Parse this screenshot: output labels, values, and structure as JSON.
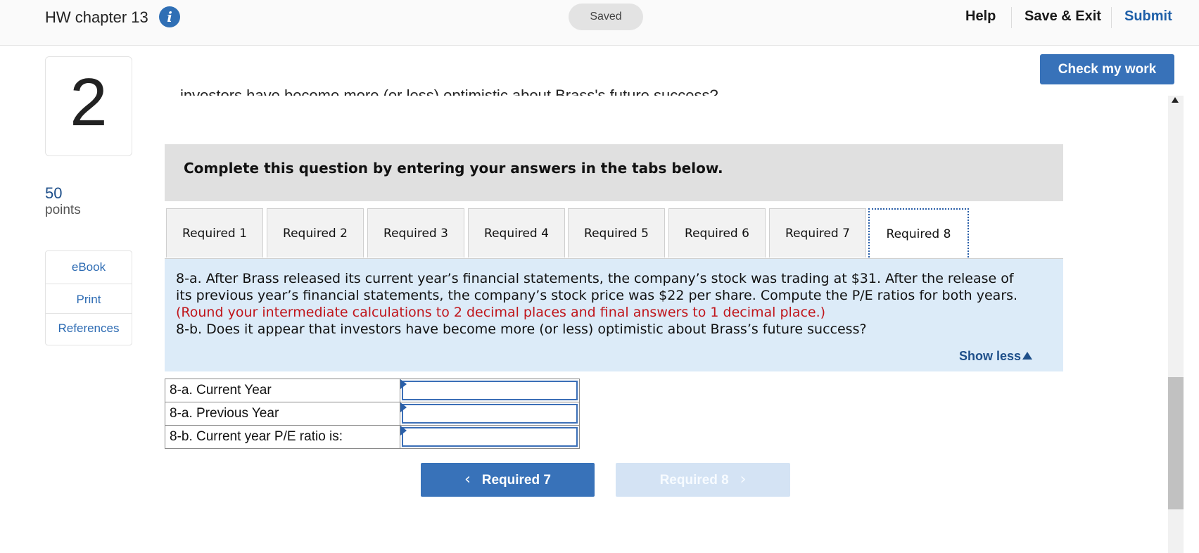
{
  "header": {
    "title": "HW chapter 13",
    "info_icon": "info-icon",
    "saved_label": "Saved",
    "help_label": "Help",
    "save_exit_label": "Save & Exit",
    "submit_label": "Submit"
  },
  "sidebar": {
    "question_number": "2",
    "points_value": "50",
    "points_label": "points",
    "links": [
      {
        "label": "eBook"
      },
      {
        "label": "Print"
      },
      {
        "label": "References"
      }
    ]
  },
  "main": {
    "check_label": "Check my work",
    "scrolled_text": "investors have become more (or less) optimistic about Brass's future success?",
    "instruction": "Complete this question by entering your answers in the tabs below.",
    "tabs": [
      {
        "label": "Required 1"
      },
      {
        "label": "Required 2"
      },
      {
        "label": "Required 3"
      },
      {
        "label": "Required 4"
      },
      {
        "label": "Required 5"
      },
      {
        "label": "Required 6"
      },
      {
        "label": "Required 7"
      },
      {
        "label": "Required 8",
        "active": true
      }
    ],
    "question_lines": {
      "line1": "8-a. After Brass released its current year’s financial statements, the company’s stock was trading at $31. After the release of",
      "line2": "its previous year’s financial statements, the company’s stock price was $22 per share. Compute the P/E ratios for both years.",
      "line3": "(Round your intermediate calculations to 2 decimal places and final answers to 1 decimal place.)",
      "line4": "8-b. Does it appear that investors have become more (or less) optimistic about Brass’s future success?"
    },
    "show_less_label": "Show less",
    "answer_rows": [
      {
        "label": "8-a. Current Year",
        "value": ""
      },
      {
        "label": "8-a. Previous Year",
        "value": ""
      },
      {
        "label": "8-b. Current year P/E ratio is:",
        "value": ""
      }
    ],
    "prev_label": "Required 7",
    "next_label": "Required 8"
  },
  "colors": {
    "accent": "#3872b9",
    "link": "#2d6bb3",
    "warning_text": "#c0151b",
    "panel_bg": "#dcebf8"
  }
}
